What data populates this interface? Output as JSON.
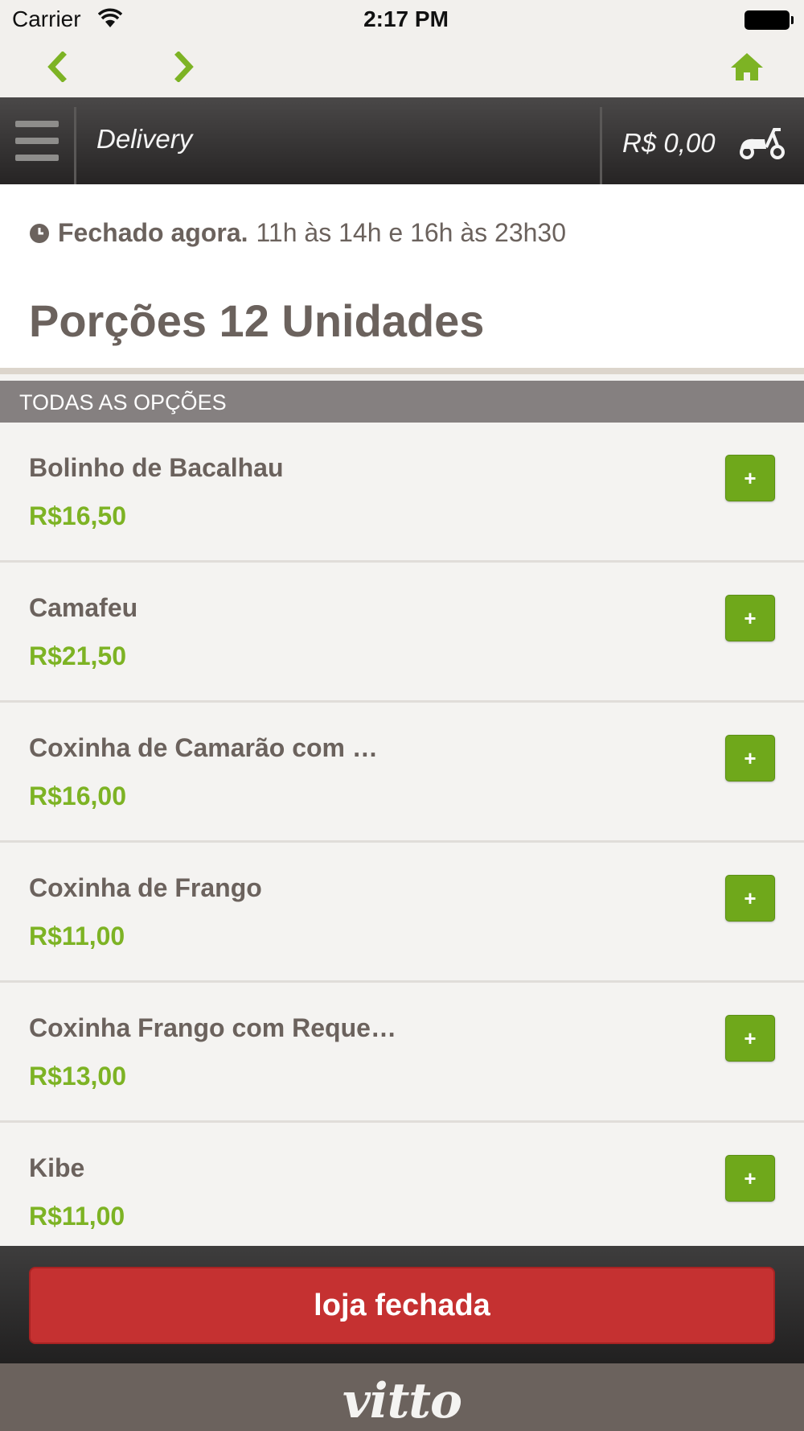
{
  "status_bar": {
    "carrier": "Carrier",
    "time": "2:17 PM"
  },
  "colors": {
    "accent_green": "#7db324",
    "closed_red": "#c53131",
    "header_dark": "#2f2d2d",
    "text_brown": "#6b625d"
  },
  "nav": {
    "back_icon": "chevron-left-icon",
    "forward_icon": "chevron-right-icon",
    "home_icon": "home-icon"
  },
  "header": {
    "title": "Delivery",
    "cart_total": "R$ 0,00",
    "menu_icon": "hamburger-icon",
    "delivery_icon": "scooter-icon"
  },
  "store": {
    "status": "Fechado agora.",
    "hours": "11h às 14h e 16h às 23h30",
    "category_title": "Porções 12 Unidades"
  },
  "section": {
    "label": "TODAS AS OPÇÕES"
  },
  "items": [
    {
      "name": "Bolinho de Bacalhau",
      "price": "R$16,50",
      "add_label": "+"
    },
    {
      "name": "Camafeu",
      "price": "R$21,50",
      "add_label": "+"
    },
    {
      "name": "Coxinha de Camarão com …",
      "price": "R$16,00",
      "add_label": "+"
    },
    {
      "name": "Coxinha de Frango",
      "price": "R$11,00",
      "add_label": "+"
    },
    {
      "name": "Coxinha Frango com Reque…",
      "price": "R$13,00",
      "add_label": "+"
    },
    {
      "name": "Kibe",
      "price": "R$11,00",
      "add_label": "+"
    }
  ],
  "footer": {
    "button_label": "loja fechada"
  },
  "brand": {
    "logo_text": "vitto"
  }
}
